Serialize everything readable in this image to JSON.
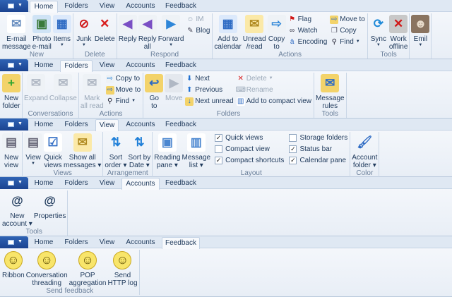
{
  "app_menu_icon": "app-menu-icon",
  "tabs": [
    "Home",
    "Folders",
    "View",
    "Accounts",
    "Feedback"
  ],
  "strips": [
    {
      "active_tab": 0,
      "groups": [
        {
          "label": "New",
          "items": [
            {
              "type": "large",
              "lines": [
                "E-mail",
                "message"
              ],
              "icon": "email-icon"
            },
            {
              "type": "large",
              "lines": [
                "Photo",
                "e-mail"
              ],
              "icon": "photo-email-icon"
            },
            {
              "type": "large",
              "lines": [
                "Items"
              ],
              "icon": "calendar-items-icon",
              "dropdown": true
            }
          ]
        },
        {
          "label": "Delete",
          "items": [
            {
              "type": "large",
              "lines": [
                "Junk"
              ],
              "icon": "junk-icon",
              "dropdown": true
            },
            {
              "type": "large",
              "lines": [
                "Delete"
              ],
              "icon": "delete-icon"
            }
          ]
        },
        {
          "label": "Respond",
          "items": [
            {
              "type": "large",
              "lines": [
                "Reply"
              ],
              "icon": "reply-icon"
            },
            {
              "type": "large",
              "lines": [
                "Reply",
                "all"
              ],
              "icon": "reply-all-icon"
            },
            {
              "type": "large",
              "lines": [
                "Forward"
              ],
              "icon": "forward-icon",
              "dropdown": true
            },
            {
              "type": "col",
              "items": [
                {
                  "label": "IM",
                  "icon": "im-icon",
                  "disabled": true
                },
                {
                  "label": "Blog",
                  "icon": "blog-icon"
                }
              ]
            }
          ]
        },
        {
          "label": "Actions",
          "items": [
            {
              "type": "large",
              "lines": [
                "Add to",
                "calendar"
              ],
              "icon": "add-calendar-icon"
            },
            {
              "type": "large",
              "lines": [
                "Unread",
                "/read"
              ],
              "icon": "unread-icon"
            },
            {
              "type": "large",
              "lines": [
                "Copy",
                "to"
              ],
              "icon": "copy-to-icon"
            },
            {
              "type": "col",
              "items": [
                {
                  "label": "Flag",
                  "icon": "flag-icon"
                },
                {
                  "label": "Watch",
                  "icon": "watch-icon"
                },
                {
                  "label": "Encoding",
                  "icon": "encoding-icon"
                }
              ]
            },
            {
              "type": "col",
              "items": [
                {
                  "label": "Move to",
                  "icon": "move-to-icon"
                },
                {
                  "label": "Copy",
                  "icon": "copy-icon"
                },
                {
                  "label": "Find",
                  "icon": "find-icon",
                  "dropdown": true
                }
              ]
            }
          ]
        },
        {
          "label": "Tools",
          "items": [
            {
              "type": "large",
              "lines": [
                "Sync"
              ],
              "icon": "sync-icon",
              "dropdown": true
            },
            {
              "type": "large",
              "lines": [
                "Work",
                "offline"
              ],
              "icon": "work-offline-icon"
            }
          ]
        },
        {
          "label": "",
          "items": [
            {
              "type": "large",
              "lines": [
                "Emil"
              ],
              "icon": "user-avatar-icon",
              "dropdown": true
            }
          ]
        }
      ]
    },
    {
      "active_tab": 1,
      "groups": [
        {
          "label": "",
          "items": [
            {
              "type": "large",
              "lines": [
                "New",
                "folder"
              ],
              "icon": "new-folder-icon"
            }
          ]
        },
        {
          "label": "Conversations",
          "items": [
            {
              "type": "large",
              "lines": [
                "Expand"
              ],
              "icon": "expand-icon",
              "disabled": true
            },
            {
              "type": "large",
              "lines": [
                "Collapse"
              ],
              "icon": "collapse-icon",
              "disabled": true
            }
          ]
        },
        {
          "label": "Actions",
          "items": [
            {
              "type": "large",
              "lines": [
                "Mark",
                "all read"
              ],
              "icon": "mark-all-read-icon",
              "disabled": true
            },
            {
              "type": "col",
              "items": [
                {
                  "label": "Copy to",
                  "icon": "copy-to-icon"
                },
                {
                  "label": "Move to",
                  "icon": "move-to-icon"
                },
                {
                  "label": "Find",
                  "icon": "find-icon",
                  "dropdown": true
                }
              ]
            }
          ]
        },
        {
          "label": "Folders",
          "items": [
            {
              "type": "large",
              "lines": [
                "Go",
                "to"
              ],
              "icon": "go-to-folder-icon"
            },
            {
              "type": "large",
              "lines": [
                "Move"
              ],
              "icon": "move-folder-icon",
              "disabled": true
            },
            {
              "type": "col",
              "items": [
                {
                  "label": "Next",
                  "icon": "next-icon"
                },
                {
                  "label": "Previous",
                  "icon": "previous-icon"
                },
                {
                  "label": "Next unread",
                  "icon": "next-unread-icon"
                }
              ]
            },
            {
              "type": "col",
              "items": [
                {
                  "label": "Delete",
                  "icon": "delete-icon",
                  "disabled": true,
                  "dropdown": true
                },
                {
                  "label": "Rename",
                  "icon": "rename-icon",
                  "disabled": true
                },
                {
                  "label": "Add to compact view",
                  "icon": "compact-view-icon"
                }
              ]
            }
          ]
        },
        {
          "label": "Tools",
          "items": [
            {
              "type": "large",
              "lines": [
                "Message",
                "rules"
              ],
              "icon": "message-rules-icon"
            }
          ]
        }
      ]
    },
    {
      "active_tab": 2,
      "groups": [
        {
          "label": "",
          "items": [
            {
              "type": "large",
              "lines": [
                "New",
                "view"
              ],
              "icon": "new-view-icon"
            }
          ]
        },
        {
          "label": "Views",
          "items": [
            {
              "type": "large",
              "lines": [
                "View"
              ],
              "icon": "view-icon",
              "dropdown": true
            },
            {
              "type": "large",
              "lines": [
                "Quick",
                "views"
              ],
              "icon": "quick-views-icon"
            },
            {
              "type": "large",
              "lines": [
                "Show all",
                "messages ▾"
              ],
              "icon": "show-all-messages-icon"
            }
          ]
        },
        {
          "label": "Arrangement",
          "items": [
            {
              "type": "large",
              "lines": [
                "Sort",
                "order ▾"
              ],
              "icon": "sort-order-icon"
            },
            {
              "type": "large",
              "lines": [
                "Sort by",
                "Date ▾"
              ],
              "icon": "sort-by-date-icon"
            }
          ]
        },
        {
          "label": "Layout",
          "items": [
            {
              "type": "large",
              "lines": [
                "Reading",
                "pane ▾"
              ],
              "icon": "reading-pane-icon"
            },
            {
              "type": "large",
              "lines": [
                "Message",
                "list ▾"
              ],
              "icon": "message-list-icon"
            },
            {
              "type": "checks",
              "items": [
                {
                  "label": "Quick views",
                  "checked": true
                },
                {
                  "label": "Compact view",
                  "checked": false
                },
                {
                  "label": "Compact shortcuts",
                  "checked": true
                }
              ]
            },
            {
              "type": "checks",
              "items": [
                {
                  "label": "Storage folders",
                  "checked": false
                },
                {
                  "label": "Status bar",
                  "checked": true
                },
                {
                  "label": "Calendar pane",
                  "checked": true
                }
              ]
            }
          ]
        },
        {
          "label": "Color",
          "items": [
            {
              "type": "large",
              "lines": [
                "Account",
                "folder ▾"
              ],
              "icon": "paintbrush-icon"
            }
          ]
        }
      ]
    },
    {
      "active_tab": 3,
      "groups": [
        {
          "label": "Tools",
          "items": [
            {
              "type": "large",
              "lines": [
                "New",
                "account ▾"
              ],
              "icon": "new-account-icon"
            },
            {
              "type": "large",
              "lines": [
                "Properties"
              ],
              "icon": "account-properties-icon"
            }
          ]
        }
      ]
    },
    {
      "active_tab": 4,
      "groups": [
        {
          "label": "Send feedback",
          "items": [
            {
              "type": "large",
              "lines": [
                "Ribbon"
              ],
              "icon": "smiley-icon"
            },
            {
              "type": "large",
              "lines": [
                "Conversation",
                "threading"
              ],
              "icon": "smiley-icon"
            },
            {
              "type": "large",
              "lines": [
                "POP",
                "aggregation"
              ],
              "icon": "smiley-icon"
            },
            {
              "type": "large",
              "lines": [
                "Send",
                "HTTP log"
              ],
              "icon": "smiley-icon"
            }
          ]
        }
      ]
    }
  ]
}
